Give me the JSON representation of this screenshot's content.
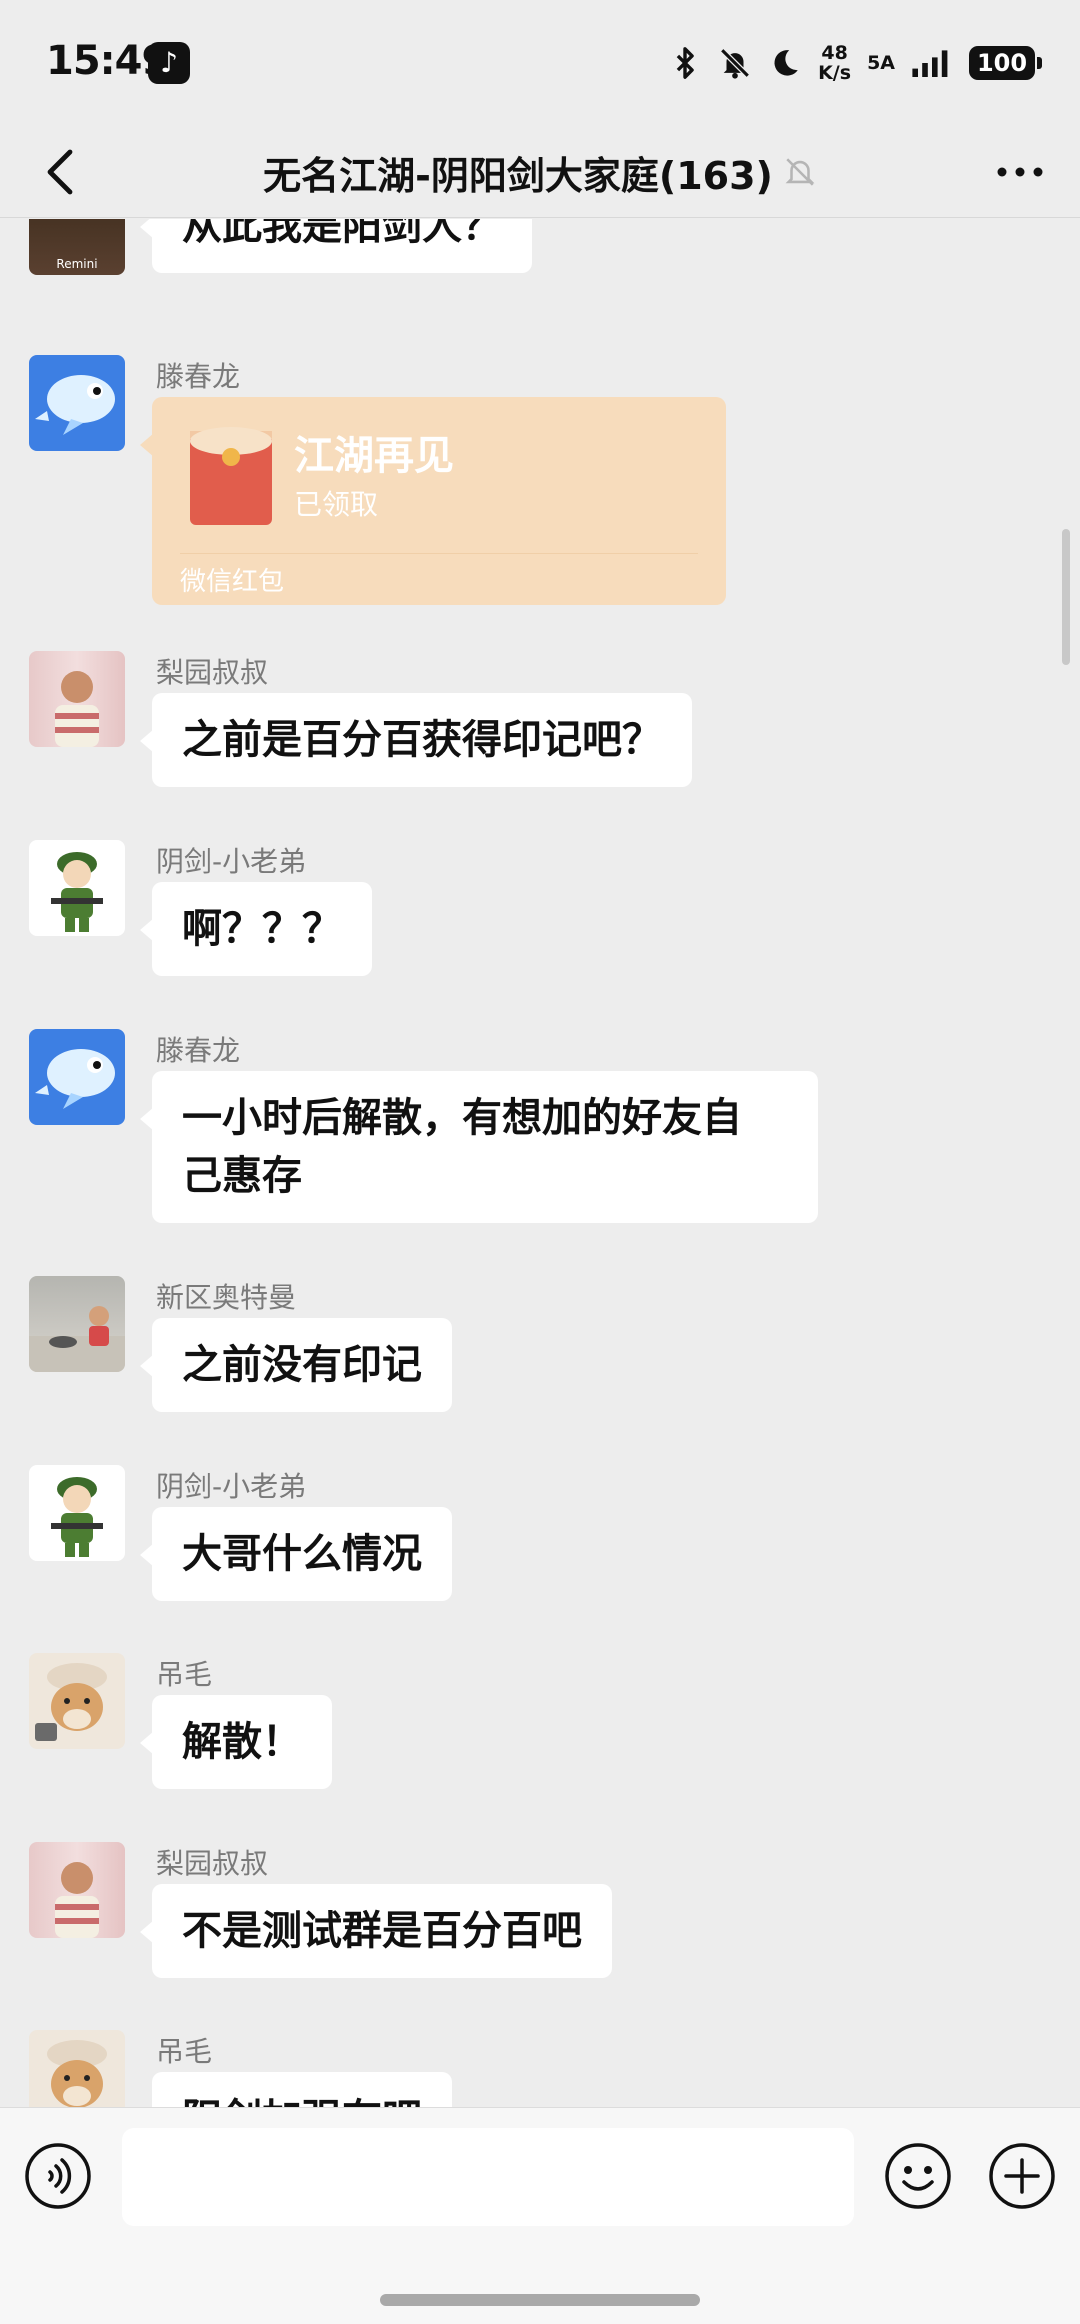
{
  "status_bar": {
    "time": "15:49",
    "net_speed_value": "48",
    "net_speed_unit": "K/s",
    "signal_label": "5A",
    "battery": "100"
  },
  "header": {
    "title": "无名江湖-阴阳剑大家庭(163)"
  },
  "messages": [
    {
      "sender": "",
      "text": "从此我是阳剑人？",
      "avatar_label": "Remini"
    },
    {
      "sender": "滕春龙",
      "type": "red_packet",
      "red_packet": {
        "title": "江湖再见",
        "status": "已领取",
        "footer": "微信红包"
      }
    },
    {
      "sender": "梨园叔叔",
      "text": "之前是百分百获得印记吧？"
    },
    {
      "sender": "阴剑-小老弟",
      "text": "啊？？？"
    },
    {
      "sender": "滕春龙",
      "text_line1": "一小时后解散，有想加的好友自",
      "text_line2": "己惠存"
    },
    {
      "sender": "新区奥特曼",
      "text": "之前没有印记"
    },
    {
      "sender": "阴剑-小老弟",
      "text": "大哥什么情况"
    },
    {
      "sender": "吊毛",
      "text": "解散！"
    },
    {
      "sender": "梨园叔叔",
      "text": "不是测试群是百分百吧"
    },
    {
      "sender": "吊毛",
      "text": "阳剑加强有吧"
    }
  ],
  "input": {
    "placeholder": ""
  },
  "colors": {
    "background": "#ededed",
    "bubble": "#ffffff",
    "red_packet": "#f7dcbc",
    "sender_name": "#7a7a7a"
  }
}
